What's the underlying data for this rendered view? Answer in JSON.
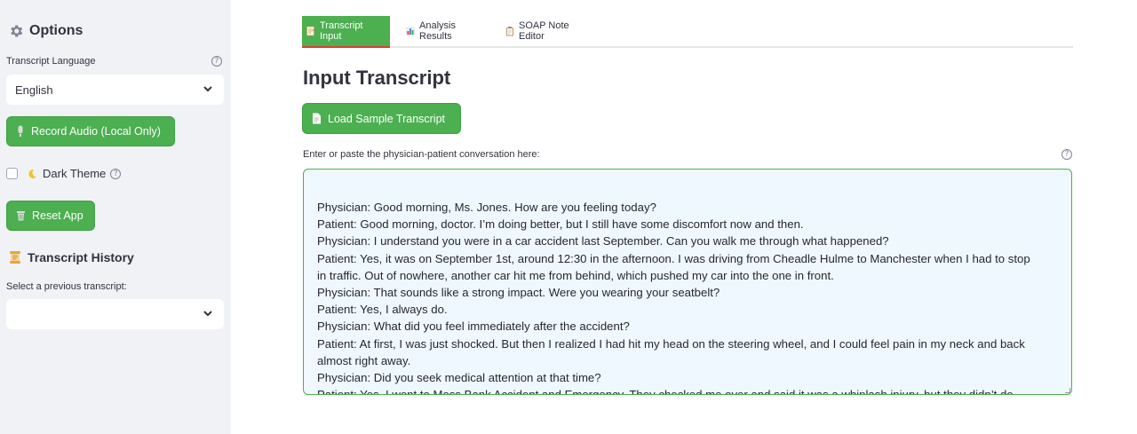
{
  "sidebar": {
    "options_title": "Options",
    "language_label": "Transcript Language",
    "language_value": "English",
    "record_button": "Record Audio (Local Only)",
    "dark_theme_label": "Dark Theme",
    "reset_button": "Reset App",
    "history_title": "Transcript History",
    "history_label": "Select a previous transcript:",
    "history_value": ""
  },
  "tabs": [
    {
      "label": "Transcript Input",
      "icon": "memo-icon",
      "active": true
    },
    {
      "label": "Analysis Results",
      "icon": "bar-chart-icon",
      "active": false
    },
    {
      "label": "SOAP Note Editor",
      "icon": "clipboard-icon",
      "active": false
    }
  ],
  "main": {
    "title": "Input Transcript",
    "load_button": "Load Sample Transcript",
    "textarea_label": "Enter or paste the physician-patient conversation here:",
    "transcript_lines": [
      "",
      "Physician: Good morning, Ms. Jones. How are you feeling today?",
      "Patient: Good morning, doctor. I’m doing better, but I still have some discomfort now and then.",
      "Physician: I understand you were in a car accident last September. Can you walk me through what happened?",
      "Patient: Yes, it was on September 1st, around 12:30 in the afternoon. I was driving from Cheadle Hulme to Manchester when I had to stop",
      "in traffic. Out of nowhere, another car hit me from behind, which pushed my car into the one in front.",
      "Physician: That sounds like a strong impact. Were you wearing your seatbelt?",
      "Patient: Yes, I always do.",
      "Physician: What did you feel immediately after the accident?",
      "Patient: At first, I was just shocked. But then I realized I had hit my head on the steering wheel, and I could feel pain in my neck and back",
      "almost right away.",
      "Physician: Did you seek medical attention at that time?",
      "Patient: Yes, I went to Moss Bank Accident and Emergency. They checked me over and said it was a whiplash injury, but they didn’t do"
    ]
  },
  "colors": {
    "accent_green": "#4caf50",
    "active_tab_underline": "#e53935",
    "sidebar_bg": "#f0f2f6",
    "textarea_bg": "#f0f8ff"
  }
}
